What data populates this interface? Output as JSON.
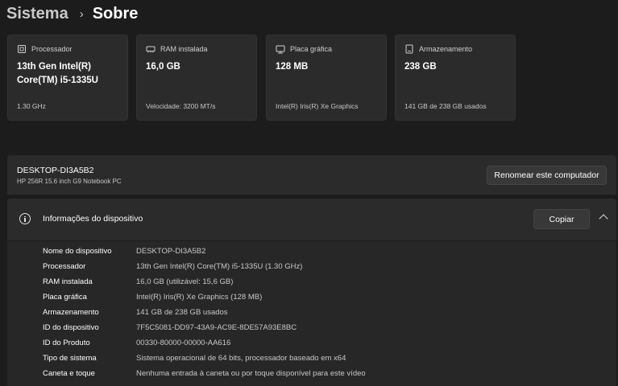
{
  "breadcrumb": {
    "parent": "Sistema",
    "separator": "›",
    "current": "Sobre"
  },
  "cards": [
    {
      "label": "Processador",
      "value": "13th Gen Intel(R) Core(TM) i5-1335U",
      "sub": "1.30 GHz",
      "icon": "processor-icon"
    },
    {
      "label": "RAM instalada",
      "value": "16,0 GB",
      "sub": "Velocidade: 3200 MT/s",
      "icon": "ram-icon"
    },
    {
      "label": "Placa gráfica",
      "value": "128 MB",
      "sub": "Intel(R) Iris(R) Xe Graphics",
      "icon": "graphics-card-icon"
    },
    {
      "label": "Armazenamento",
      "value": "238 GB",
      "sub": "141 GB de 238 GB usados",
      "icon": "storage-icon"
    }
  ],
  "pc": {
    "name": "DESKTOP-DI3A5B2",
    "model": "HP 256R 15.6 inch G9 Notebook PC",
    "rename_label": "Renomear este computador"
  },
  "device_info": {
    "title": "Informações do dispositivo",
    "copy_label": "Copiar",
    "rows": [
      {
        "label": "Nome do dispositivo",
        "value": "DESKTOP-DI3A5B2"
      },
      {
        "label": "Processador",
        "value": "13th Gen Intel(R) Core(TM) i5-1335U (1.30 GHz)"
      },
      {
        "label": "RAM instalada",
        "value": "16,0 GB (utilizável: 15,6 GB)"
      },
      {
        "label": "Placa gráfica",
        "value": "Intel(R) Iris(R) Xe Graphics (128 MB)"
      },
      {
        "label": "Armazenamento",
        "value": "141 GB de 238 GB usados"
      },
      {
        "label": "ID do dispositivo",
        "value": "7F5C5081-DD97-43A9-AC9E-8DE57A93E8BC"
      },
      {
        "label": "ID do Produto",
        "value": "00330-80000-00000-AA616"
      },
      {
        "label": "Tipo de sistema",
        "value": "Sistema operacional de 64 bits, processador baseado em x64"
      },
      {
        "label": "Caneta e toque",
        "value": "Nenhuma entrada à caneta ou por toque disponível para este vídeo"
      }
    ]
  },
  "colors": {
    "background": "#1c1c1c",
    "card": "#2b2b2b",
    "button": "#383838"
  }
}
